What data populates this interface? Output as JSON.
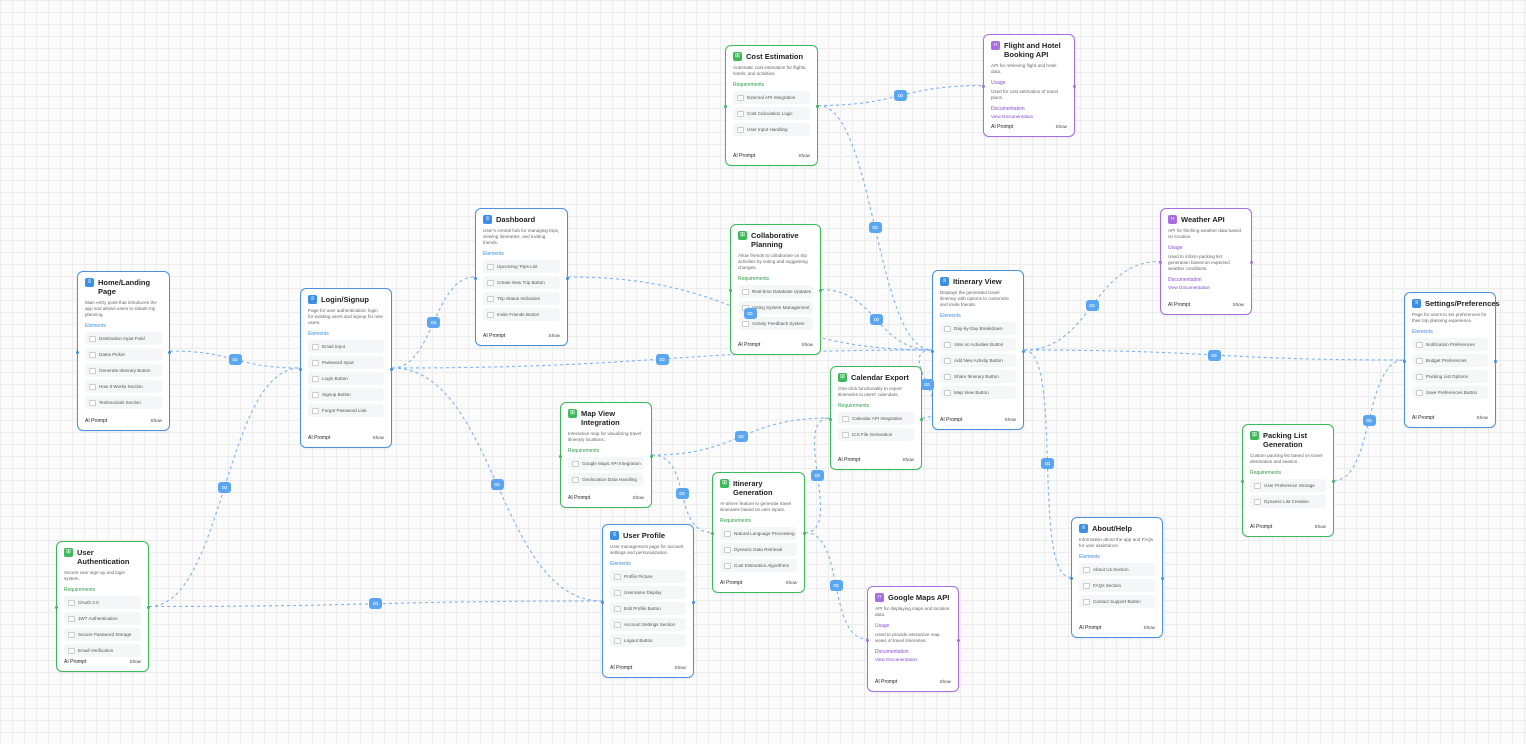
{
  "labels": {
    "elements": "Elements",
    "requirements": "Requirements",
    "usage": "Usage",
    "documentation": "Documentation",
    "view_documentation": "View Documentation",
    "ai_prompt": "AI Prompt",
    "show": "Show"
  },
  "colors": {
    "page_border": "#4a90e2",
    "feature_border": "#3cb95a",
    "api_border": "#a66ee0",
    "edge": "#7fb2f0"
  },
  "icons": {
    "page": "page-icon",
    "feature": "grid-icon",
    "api": "code-icon",
    "edge_badge": "link-icon"
  },
  "nodes": [
    {
      "id": "home",
      "kind": "page",
      "title": "Home/Landing Page",
      "description": "Main entry point that introduces the app and allows users to initiate trip planning.",
      "items": [
        "Destination Input Field",
        "Dates Picker",
        "Generate Itinerary Button",
        "How It Works Section",
        "Testimonials Section"
      ]
    },
    {
      "id": "login",
      "kind": "page",
      "title": "Login/Signup",
      "description": "Page for user authentication: login for existing users and signup for new users.",
      "items": [
        "Email Input",
        "Password Input",
        "Login Button",
        "Signup Button",
        "Forgot Password Link"
      ]
    },
    {
      "id": "dashboard",
      "kind": "page",
      "title": "Dashboard",
      "description": "User's central hub for managing trips, viewing itineraries, and inviting friends.",
      "items": [
        "Upcoming Trips List",
        "Create New Trip Button",
        "Trip Status Indicators",
        "Invite Friends Button"
      ]
    },
    {
      "id": "cost",
      "kind": "feature",
      "title": "Cost Estimation",
      "description": "Automatic cost estimation for flights, hotels, and activities.",
      "items": [
        "External API Integration",
        "Cost Calculation Logic",
        "User Input Handling"
      ]
    },
    {
      "id": "flight",
      "kind": "api",
      "title": "Flight and Hotel Booking API",
      "description": "API for retrieving flight and hotel data.",
      "usage": "Used for cost estimation of travel plans."
    },
    {
      "id": "collab",
      "kind": "feature",
      "title": "Collaborative Planning",
      "description": "Allow friends to collaborate on trip activities by voting and suggesting changes.",
      "items": [
        "Real-time Database Updates",
        "Voting System Management",
        "Activity Feedback System"
      ]
    },
    {
      "id": "weather",
      "kind": "api",
      "title": "Weather API",
      "description": "API for fetching weather data based on location.",
      "usage": "Used to inform packing list generation based on expected weather conditions."
    },
    {
      "id": "itinerary",
      "kind": "page",
      "title": "Itinerary View",
      "description": "Displays the generated travel itinerary with options to customize and invite friends.",
      "items": [
        "Day-by-Day Breakdown",
        "Vote on Activities Button",
        "Add New Activity Button",
        "Share Itinerary Button",
        "Map View Button"
      ]
    },
    {
      "id": "settings",
      "kind": "page",
      "title": "Settings/Preferences",
      "description": "Page for users to set preferences for their trip planning experience.",
      "items": [
        "Notification Preferences",
        "Budget Preferences",
        "Packing List Options",
        "Save Preferences Button"
      ]
    },
    {
      "id": "calendar",
      "kind": "feature",
      "title": "Calendar Export",
      "description": "One-click functionality to export itineraries to users' calendars.",
      "items": [
        "Calendar API Integration",
        "ICS File Generation"
      ]
    },
    {
      "id": "mapview",
      "kind": "feature",
      "title": "Map View Integration",
      "description": "Interactive map for visualizing travel itinerary locations.",
      "items": [
        "Google Maps API Integration",
        "Geolocation Data Handling"
      ]
    },
    {
      "id": "packing",
      "kind": "feature",
      "title": "Packing List Generation",
      "description": "Custom packing list based on travel destination and season.",
      "items": [
        "User Preference Storage",
        "Dynamic List Creation"
      ]
    },
    {
      "id": "auth",
      "kind": "feature",
      "title": "User Authentication",
      "description": "Secure user sign-up and login system.",
      "items": [
        "OAuth 2.0",
        "JWT Authentication",
        "Secure Password Storage",
        "Email Verification"
      ]
    },
    {
      "id": "gen",
      "kind": "feature",
      "title": "Itinerary Generation",
      "description": "AI-driven feature to generate travel itineraries based on user inputs.",
      "items": [
        "Natural Language Processing",
        "Dynamic Data Retrieval",
        "Cost Estimation Algorithms"
      ]
    },
    {
      "id": "profile",
      "kind": "page",
      "title": "User Profile",
      "description": "User management page for account settings and personalization.",
      "items": [
        "Profile Picture",
        "Username Display",
        "Edit Profile Button",
        "Account Settings Section",
        "Logout Button"
      ]
    },
    {
      "id": "about",
      "kind": "page",
      "title": "About/Help",
      "description": "Information about the app and FAQs for user assistance.",
      "items": [
        "About Us Section",
        "FAQs Section",
        "Contact Support Button"
      ]
    },
    {
      "id": "gmaps",
      "kind": "api",
      "title": "Google Maps API",
      "description": "API for displaying maps and location data.",
      "usage": "Used to provide interactive map views of travel itineraries."
    }
  ],
  "edges": [
    [
      "home",
      "login"
    ],
    [
      "auth",
      "login"
    ],
    [
      "auth",
      "profile"
    ],
    [
      "login",
      "dashboard"
    ],
    [
      "login",
      "itinerary"
    ],
    [
      "login",
      "profile"
    ],
    [
      "dashboard",
      "itinerary"
    ],
    [
      "cost",
      "flight"
    ],
    [
      "cost",
      "itinerary"
    ],
    [
      "collab",
      "itinerary"
    ],
    [
      "itinerary",
      "weather"
    ],
    [
      "itinerary",
      "settings"
    ],
    [
      "itinerary",
      "about"
    ],
    [
      "calendar",
      "itinerary"
    ],
    [
      "mapview",
      "calendar"
    ],
    [
      "mapview",
      "gen"
    ],
    [
      "gen",
      "calendar"
    ],
    [
      "gen",
      "gmaps"
    ],
    [
      "packing",
      "settings"
    ]
  ]
}
